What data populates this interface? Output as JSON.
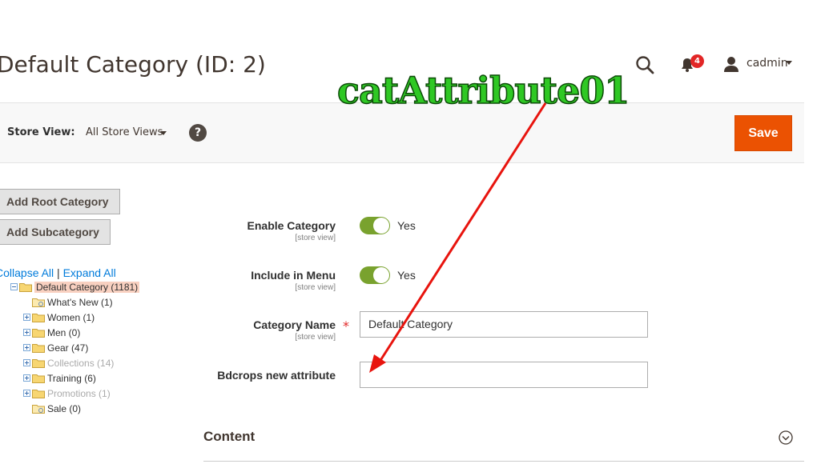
{
  "header": {
    "page_title": "Default Category (ID: 2)",
    "notifications_count": "4",
    "username": "cadmin"
  },
  "toolbar": {
    "store_view_label": "Store View:",
    "store_view_value": "All Store Views",
    "help_glyph": "?",
    "save_label": "Save"
  },
  "sidebar": {
    "add_root_label": "Add Root Category",
    "add_sub_label": "Add Subcategory",
    "collapse_all": "Collapse All",
    "separator": "|",
    "expand_all": "Expand All",
    "tree": [
      {
        "label": "Default Category (1181)",
        "level": 0,
        "root": true,
        "muted": false
      },
      {
        "label": "What's New (1)",
        "level": 1,
        "muted": false
      },
      {
        "label": "Women (1)",
        "level": 1,
        "muted": false
      },
      {
        "label": "Men (0)",
        "level": 1,
        "muted": false
      },
      {
        "label": "Gear (47)",
        "level": 1,
        "muted": false
      },
      {
        "label": "Collections (14)",
        "level": 1,
        "muted": true
      },
      {
        "label": "Training (6)",
        "level": 1,
        "muted": false
      },
      {
        "label": "Promotions (1)",
        "level": 1,
        "muted": true
      },
      {
        "label": "Sale (0)",
        "level": 1,
        "muted": false
      }
    ]
  },
  "form": {
    "enable_category": {
      "label": "Enable Category",
      "scope": "[store view]",
      "value": "Yes"
    },
    "include_in_menu": {
      "label": "Include in Menu",
      "scope": "[store view]",
      "value": "Yes"
    },
    "category_name": {
      "label": "Category Name",
      "scope": "[store view]",
      "required_mark": "*",
      "value": "Default Category"
    },
    "bdcrops_attr": {
      "label": "Bdcrops new attribute",
      "value": ""
    },
    "content_section": "Content"
  },
  "annotation": {
    "text": "catAttribute01",
    "color": "#2fc824",
    "arrow_color": "#e8140e"
  },
  "colors": {
    "accent": "#eb5202",
    "toggle_on": "#79a22e",
    "link": "#007bdb",
    "badge": "#e22626"
  },
  "icons": [
    "search-icon",
    "bell-icon",
    "user-icon",
    "question-icon",
    "folder-icon",
    "chevron-down-circle-icon"
  ]
}
